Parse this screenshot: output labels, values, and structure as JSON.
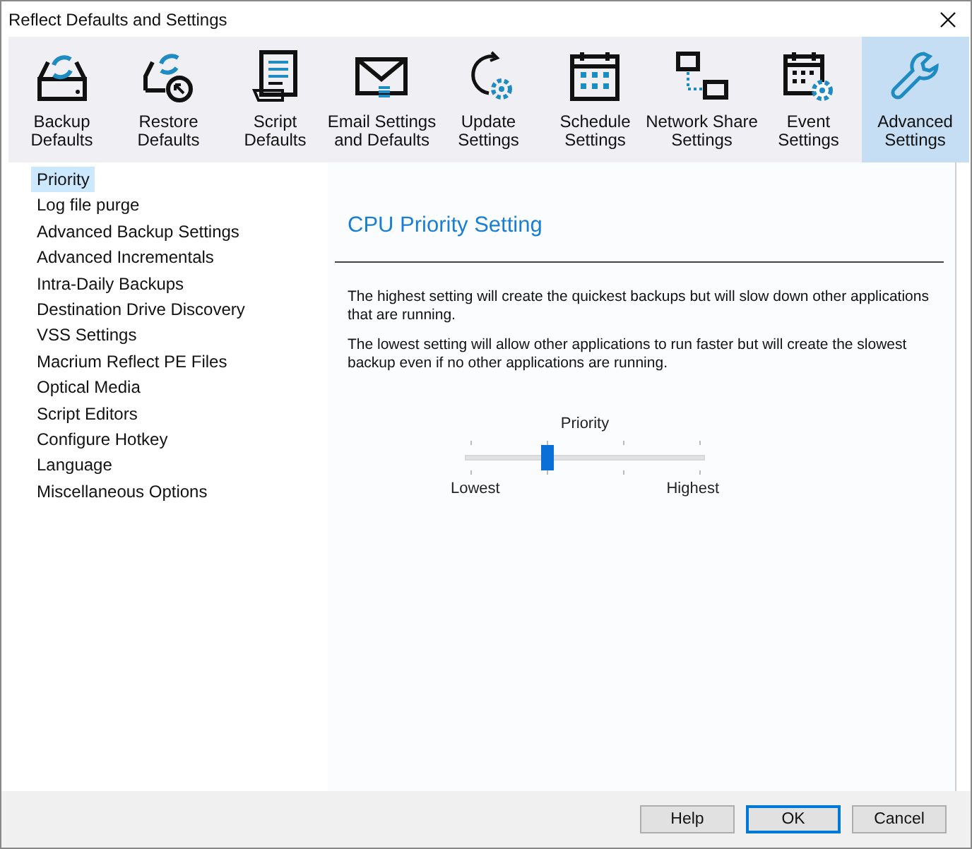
{
  "window": {
    "title": "Reflect Defaults and Settings"
  },
  "toolbar": [
    {
      "label": "Backup\nDefaults",
      "selected": false
    },
    {
      "label": "Restore\nDefaults",
      "selected": false
    },
    {
      "label": "Script\nDefaults",
      "selected": false
    },
    {
      "label": "Email Settings\nand Defaults",
      "selected": false
    },
    {
      "label": "Update\nSettings",
      "selected": false
    },
    {
      "label": "Schedule\nSettings",
      "selected": false
    },
    {
      "label": "Network Share\nSettings",
      "selected": false
    },
    {
      "label": "Event\nSettings",
      "selected": false
    },
    {
      "label": "Advanced\nSettings",
      "selected": true
    }
  ],
  "sidebar": {
    "items": [
      {
        "label": "Priority",
        "selected": true
      },
      {
        "label": "Log file purge",
        "selected": false
      },
      {
        "label": "Advanced Backup Settings",
        "selected": false
      },
      {
        "label": "Advanced Incrementals",
        "selected": false
      },
      {
        "label": "Intra-Daily Backups",
        "selected": false
      },
      {
        "label": "Destination Drive Discovery",
        "selected": false
      },
      {
        "label": "VSS Settings",
        "selected": false
      },
      {
        "label": "Macrium Reflect PE Files",
        "selected": false
      },
      {
        "label": "Optical Media",
        "selected": false
      },
      {
        "label": "Script Editors",
        "selected": false
      },
      {
        "label": "Configure Hotkey",
        "selected": false
      },
      {
        "label": "Language",
        "selected": false
      },
      {
        "label": "Miscellaneous Options",
        "selected": false
      }
    ]
  },
  "panel": {
    "title": "CPU Priority Setting",
    "paragraphs": [
      "The highest setting will create the quickest backups but will slow down other applications that are running.",
      "The lowest setting will allow other applications to run faster but will create the slowest backup even if no other applications are running."
    ],
    "slider": {
      "label": "Priority",
      "level": 0.3333,
      "min_label": "Lowest",
      "max_label": "Highest"
    }
  },
  "buttons": [
    {
      "label": "Help",
      "default": false
    },
    {
      "label": "OK",
      "default": true
    },
    {
      "label": "Cancel",
      "default": false
    }
  ]
}
